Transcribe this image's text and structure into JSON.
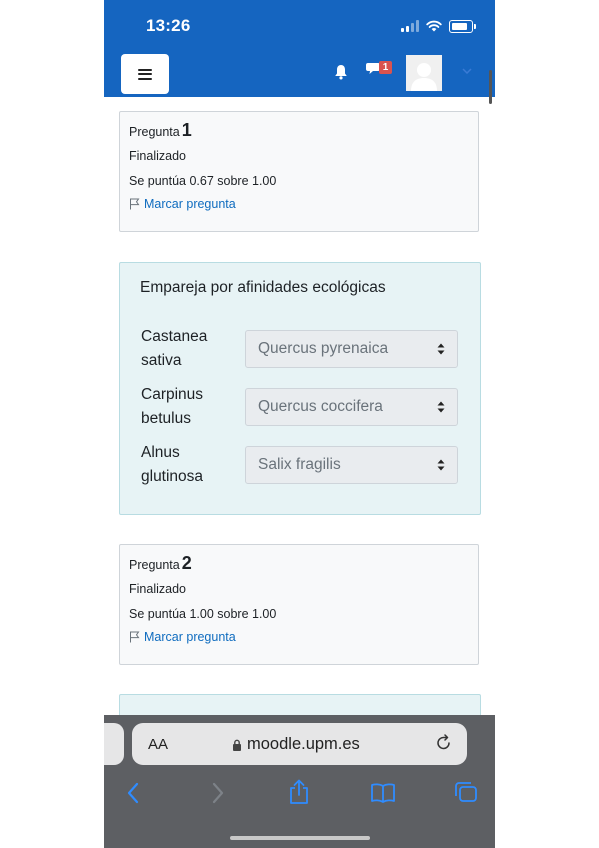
{
  "status_bar": {
    "time": "13:26"
  },
  "header": {
    "notification_count": "1"
  },
  "questions": [
    {
      "label": "Pregunta",
      "number": "1",
      "state": "Finalizado",
      "grade": "Se puntúa 0.67 sobre 1.00",
      "flag_label": "Marcar pregunta"
    },
    {
      "label": "Pregunta",
      "number": "2",
      "state": "Finalizado",
      "grade": "Se puntúa 1.00 sobre 1.00",
      "flag_label": "Marcar pregunta"
    }
  ],
  "match": {
    "prompt": "Empareja por afinidades ecológicas",
    "rows": [
      {
        "line1": "Castanea",
        "line2": "sativa",
        "selected": "Quercus pyrenaica"
      },
      {
        "line1": "Carpinus",
        "line2": "betulus",
        "selected": "Quercus coccifera"
      },
      {
        "line1": "Alnus",
        "line2": "glutinosa",
        "selected": "Salix fragilis"
      }
    ]
  },
  "browser": {
    "text_size_label": "AA",
    "url": "moodle.upm.es"
  },
  "colors": {
    "header": "#1565c0",
    "link": "#0f6cbf",
    "content_bg": "#e7f3f5",
    "badge": "#d9534f"
  }
}
